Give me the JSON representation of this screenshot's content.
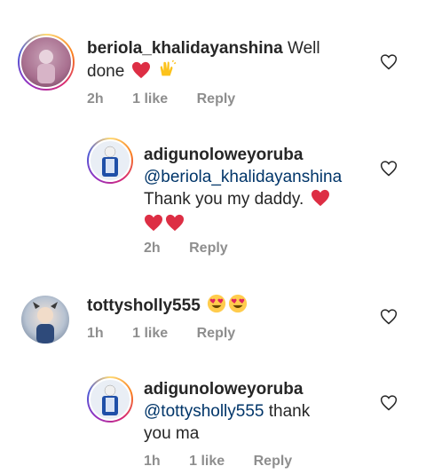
{
  "comments": [
    {
      "username": "beriola_khalidayanshina",
      "text": "Well done",
      "time": "2h",
      "likes": "1 like",
      "reply": "Reply",
      "emojis": [
        "heart-icon",
        "clapping-hands-icon"
      ]
    },
    {
      "username": "adigunoloweyoruba",
      "mention": "@beriola_khalidayanshina",
      "text": "Thank you  my daddy.",
      "time": "2h",
      "reply": "Reply",
      "emojis": [
        "heart-icon",
        "heart-icon",
        "heart-icon"
      ]
    },
    {
      "username": "tottysholly555",
      "text": "",
      "time": "1h",
      "likes": "1 like",
      "reply": "Reply",
      "emojis": [
        "heart-eyes-icon",
        "heart-eyes-icon"
      ]
    },
    {
      "username": "adigunoloweyoruba",
      "mention": "@tottysholly555",
      "text": "thank",
      "text2": "you ma",
      "time": "1h",
      "likes": "1 like",
      "reply": "Reply"
    }
  ],
  "colors": {
    "heart": "#e0245e",
    "mention": "#003569",
    "meta": "#8e8e8e"
  }
}
